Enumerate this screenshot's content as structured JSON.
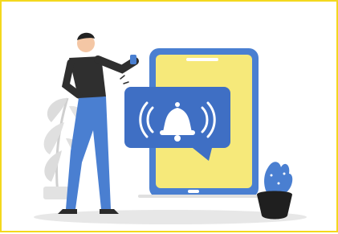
{
  "scene": {
    "subject": "",
    "colors": {
      "frame": "#f4d81e",
      "phone_body": "#4a7fd1",
      "phone_screen": "#f6e97a",
      "bubble": "#3f6fc4",
      "bell": "#ffffff",
      "person_shirt": "#2f2f2f",
      "person_pants": "#4a7fd1",
      "plant_leaf_gray": "#d8d8d8",
      "cactus": "#4a7fd1",
      "pot": "#1f1f1f",
      "floor": "#e5e5e5"
    },
    "icons": [
      "bell-icon",
      "phone-icon",
      "person-illustration",
      "plant-illustration",
      "cactus-illustration"
    ]
  }
}
